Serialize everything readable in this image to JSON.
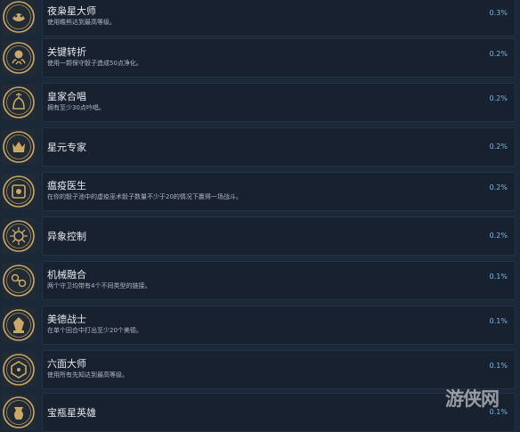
{
  "colors": {
    "background": "#1b2838",
    "card": "#182130",
    "card_border": "#243245",
    "title": "#e6e9ec",
    "description": "#aeb6bf",
    "percent": "#7bb8e0",
    "icon_gold": "#c9a96a"
  },
  "achievements": [
    {
      "title": "夜枭星大师",
      "description": "使用瞻熊达到最高等级。",
      "percent": "0.3%",
      "icon": "owl-emblem-icon"
    },
    {
      "title": "关键转折",
      "description": "使用一颗保守骰子造成50点净化。",
      "percent": "0.2%",
      "icon": "octopus-emblem-icon"
    },
    {
      "title": "皇家合唱",
      "description": "拥有至少30点吟唱。",
      "percent": "0.2%",
      "icon": "bird-emblem-icon"
    },
    {
      "title": "星元专家",
      "description": "",
      "percent": "0.2%",
      "icon": "crown-emblem-icon"
    },
    {
      "title": "瘟疫医生",
      "description": "在你的骰子池中的虚疫巫术骰子数量不少于20的情况下赢得一场战斗。",
      "percent": "0.2%",
      "icon": "plague-emblem-icon"
    },
    {
      "title": "异象控制",
      "description": "",
      "percent": "0.2%",
      "icon": "sun-emblem-icon"
    },
    {
      "title": "机械融合",
      "description": "两个守卫均带有4个不同类型的链接。",
      "percent": "0.1%",
      "icon": "chain-emblem-icon"
    },
    {
      "title": "美德战士",
      "description": "在单个回合中打出至少20个美德。",
      "percent": "0.1%",
      "icon": "warrior-emblem-icon"
    },
    {
      "title": "六面大师",
      "description": "使用所有先知达到最高等级。",
      "percent": "0.1%",
      "icon": "dice-emblem-icon"
    },
    {
      "title": "宝瓶星英雄",
      "description": "",
      "percent": "0.1%",
      "icon": "urn-emblem-icon"
    }
  ],
  "watermark": "游侠网"
}
